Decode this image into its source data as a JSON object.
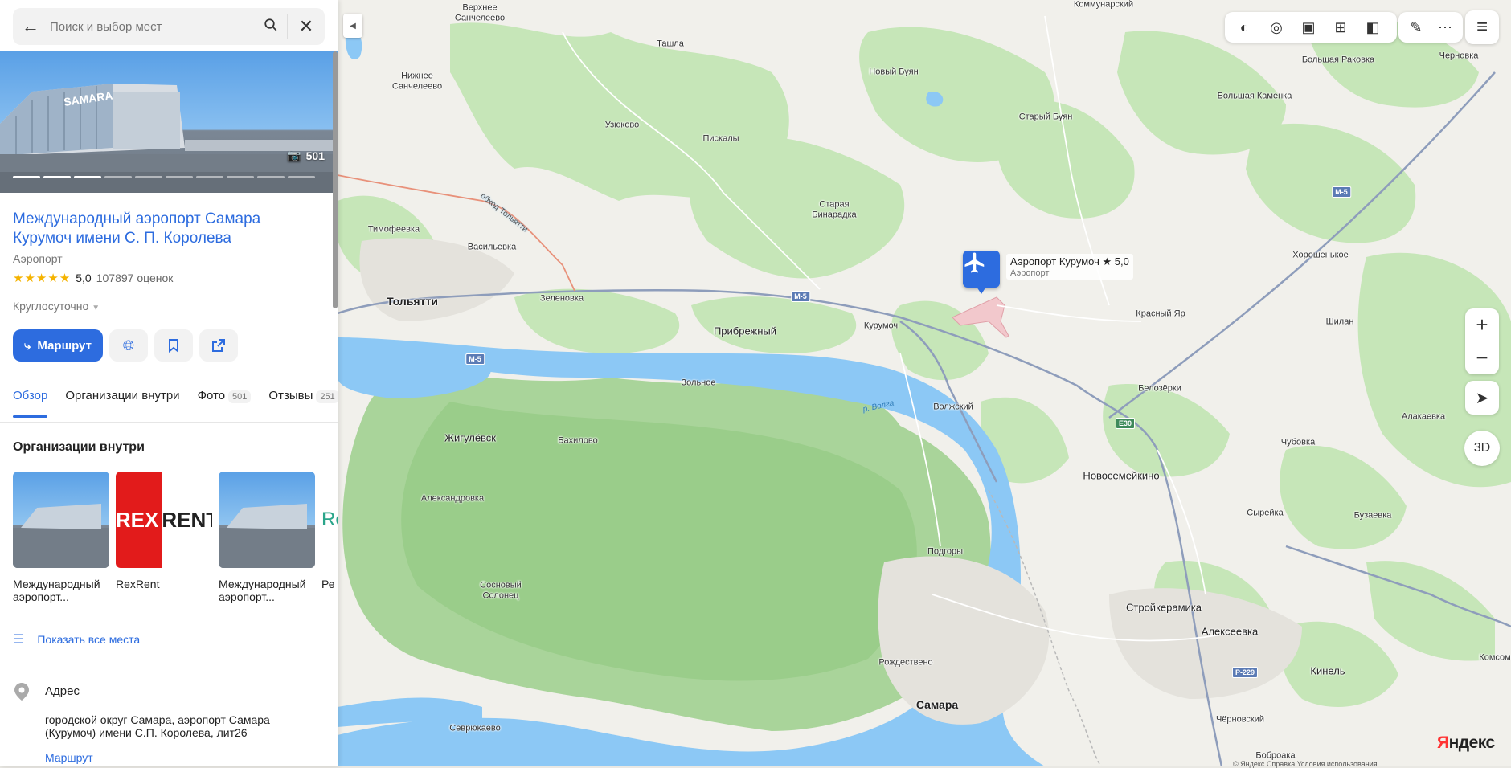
{
  "search": {
    "placeholder": "Поиск и выбор мест"
  },
  "photo": {
    "count": "501"
  },
  "place": {
    "title": "Международный аэропорт Самара Курумоч имени С. П. Королева",
    "type": "Аэропорт",
    "rating": "5,0",
    "stars": "★★★★★",
    "ratings_count": "107897 оценок",
    "hours": "Круглосуточно"
  },
  "actions": {
    "route_label": "Маршрут"
  },
  "tabs": [
    {
      "label": "Обзор",
      "count": ""
    },
    {
      "label": "Организации внутри",
      "count": ""
    },
    {
      "label": "Фото",
      "count": "501"
    },
    {
      "label": "Отзывы",
      "count": "251"
    }
  ],
  "orgs": {
    "title": "Организации внутри",
    "items": [
      {
        "name": "Международный аэропорт..."
      },
      {
        "name": "RexRent",
        "logo_left": "REX",
        "logo_right": "RENT"
      },
      {
        "name": "Международный аэропорт..."
      },
      {
        "name": "Ре",
        "logo_text": "Re"
      }
    ],
    "show_all": "Показать все места"
  },
  "address": {
    "title": "Адрес",
    "text": "городской округ Самара, аэропорт Самара (Курумоч) имени С.П. Королева, лит26",
    "route_link": "Маршрут"
  },
  "map": {
    "airport": {
      "name": "Аэропорт Курумоч",
      "rating": "★ 5,0",
      "type": "Аэропорт"
    },
    "labels": [
      "Коммунарский",
      "Верхнее Санчелеево",
      "Ташла",
      "Нижнее Санчелеево",
      "Новый Буян",
      "Большая Раковка",
      "Черновка",
      "Большая Каменка",
      "Узюково",
      "Старый Буян",
      "Пискалы",
      "Старая Бинарадка",
      "Тимофеевка",
      "Васильевка",
      "Хорошенькое",
      "Тольятти",
      "Зеленовка",
      "Прибрежный",
      "Курумоч",
      "Красный Яр",
      "Шилан",
      "Зольное",
      "Волжский",
      "Белозёрки",
      "Алакаевка",
      "Жигулёвск",
      "Бахилово",
      "Чубовка",
      "Новосемейкино",
      "Александровка",
      "Сырейка",
      "Бузаевка",
      "Подгоры",
      "Сосновый Солонец",
      "Стройкерамика",
      "Алексеевка",
      "Кинель",
      "Комсом",
      "Рождествено",
      "Самара",
      "Севрюкаево",
      "Чёрновский",
      "Боброака"
    ],
    "roads": [
      "М-5",
      "М-5",
      "М-5",
      "Е30",
      "Р-229"
    ],
    "river": "р. Волга",
    "bypass": "обход Тольятти",
    "logo_black": "Я",
    "logo_red": "ндекс",
    "copyright": "© Яндекс   Справка   Условия использования",
    "btn_3d": "3D"
  },
  "colors": {
    "accent": "#2d6cdf",
    "water": "#8cc8f5",
    "forest": "#c6e6b8",
    "land": "#f1f0eb"
  }
}
